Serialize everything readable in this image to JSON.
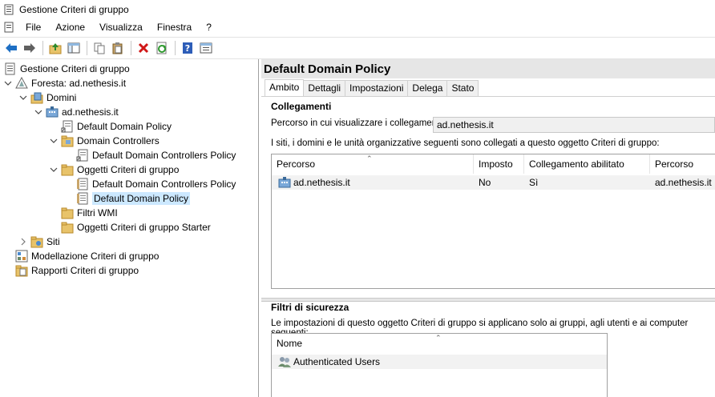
{
  "window": {
    "title": "Gestione Criteri di gruppo"
  },
  "menu": [
    "File",
    "Azione",
    "Visualizza",
    "Finestra",
    "?"
  ],
  "toolbar_icons": [
    "back-icon",
    "forward-icon",
    "up-folder-icon",
    "show-hide-tree-icon",
    "copy-icon",
    "paste-icon",
    "delete-icon",
    "refresh-icon",
    "help-icon",
    "properties-icon"
  ],
  "tree": [
    {
      "label": "Gestione Criteri di gruppo",
      "level": 0,
      "exp": "",
      "icon": "gpmc"
    },
    {
      "label": "Foresta: ad.nethesis.it",
      "level": 0,
      "exp": "open",
      "icon": "forest"
    },
    {
      "label": "Domini",
      "level": 1,
      "exp": "open",
      "icon": "domains"
    },
    {
      "label": "ad.nethesis.it",
      "level": 2,
      "exp": "open",
      "icon": "domain"
    },
    {
      "label": "Default Domain Policy",
      "level": 3,
      "exp": "",
      "icon": "gpo-link"
    },
    {
      "label": "Domain Controllers",
      "level": 3,
      "exp": "open",
      "icon": "ou"
    },
    {
      "label": "Default Domain Controllers Policy",
      "level": 4,
      "exp": "",
      "icon": "gpo-link"
    },
    {
      "label": "Oggetti Criteri di gruppo",
      "level": 3,
      "exp": "open",
      "icon": "folder"
    },
    {
      "label": "Default Domain Controllers Policy",
      "level": 4,
      "exp": "",
      "icon": "gpo"
    },
    {
      "label": "Default Domain Policy",
      "level": 4,
      "exp": "",
      "icon": "gpo",
      "selected": true
    },
    {
      "label": "Filtri WMI",
      "level": 3,
      "exp": "",
      "icon": "folder"
    },
    {
      "label": "Oggetti Criteri di gruppo Starter",
      "level": 3,
      "exp": "",
      "icon": "folder"
    },
    {
      "label": "Siti",
      "level": 1,
      "exp": "closed",
      "icon": "sites"
    },
    {
      "label": "Modellazione Criteri di gruppo",
      "level": 0,
      "exp": "",
      "icon": "modeling"
    },
    {
      "label": "Rapporti Criteri di gruppo",
      "level": 0,
      "exp": "",
      "icon": "reports"
    }
  ],
  "details": {
    "title": "Default Domain Policy",
    "tabs": [
      "Ambito",
      "Dettagli",
      "Impostazioni",
      "Delega",
      "Stato"
    ],
    "links_heading": "Collegamenti",
    "location_label": "Percorso in cui visualizzare i collegamenti:",
    "location_value": "ad.nethesis.it",
    "links_desc": "I siti, i domini e le unità organizzative seguenti sono collegati a questo oggetto Criteri di gruppo:",
    "links_columns": [
      "Percorso",
      "Imposto",
      "Collegamento abilitato",
      "Percorso"
    ],
    "links_rows": [
      [
        "ad.nethesis.it",
        "No",
        "Sì",
        "ad.nethesis.it"
      ]
    ],
    "filter_heading": "Filtri di sicurezza",
    "filter_desc": "Le impostazioni di questo oggetto Criteri di gruppo si applicano solo ai gruppi, agli utenti e ai computer seguenti:",
    "filter_column": "Nome",
    "filter_rows": [
      "Authenticated Users"
    ]
  }
}
